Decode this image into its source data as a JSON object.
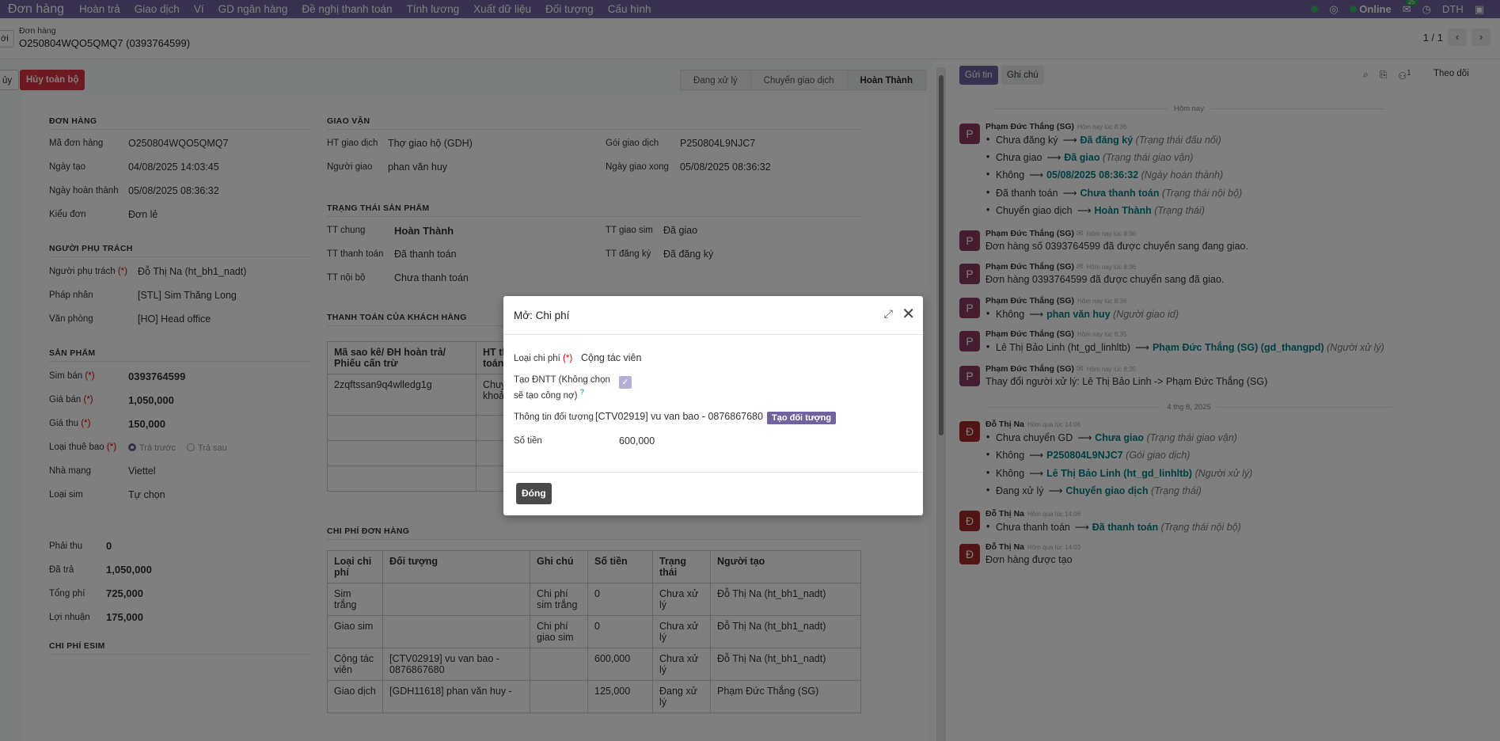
{
  "nav": {
    "app": "Đơn hàng",
    "menus": [
      "Hoàn trả",
      "Giao dịch",
      "Ví",
      "GD ngân hàng",
      "Đề nghị thanh toán",
      "Tính lương",
      "Xuất dữ liệu",
      "Đối tượng",
      "Cấu hình"
    ],
    "status": "Online",
    "msg_count": "25",
    "company": "DTH"
  },
  "control": {
    "new_label": "ới",
    "breadcrumb_parent": "Đơn hàng",
    "breadcrumb_current": "O250804WQO5QMQ7 (0393764599)",
    "pager": "1 / 1"
  },
  "statusbar": {
    "cancel_label": "ủy",
    "cancel_all_label": "Hủy toàn bộ",
    "steps": [
      "Đang xử lý",
      "Chuyển giao dịch",
      "Hoàn Thành"
    ]
  },
  "order": {
    "title": "ĐƠN HÀNG",
    "code_label": "Mã đơn hàng",
    "code": "O250804WQO5QMQ7",
    "created_label": "Ngày tạo",
    "created": "04/08/2025 14:03:45",
    "done_label": "Ngày hoàn thành",
    "done": "05/08/2025 08:36:32",
    "type_label": "Kiểu đơn",
    "type": "Đơn lẻ"
  },
  "owner": {
    "title": "NGƯỜI PHỤ TRÁCH",
    "person_label": "Người phụ trách",
    "person": "Đỗ Thị Na (ht_bh1_nadt)",
    "entity_label": "Pháp nhân",
    "entity": "[STL] Sim Thăng Long",
    "office_label": "Văn phòng",
    "office": "[HO] Head office"
  },
  "product": {
    "title": "SẢN PHẨM",
    "sim_label": "Sim bán",
    "sim": "0393764599",
    "price_label": "Giá bán",
    "price": "1,050,000",
    "collect_label": "Giá thu",
    "collect": "150,000",
    "sub_label": "Loại thuê bao",
    "sub_opt1": "Trả trước",
    "sub_opt2": "Trả sau",
    "carrier_label": "Nhà mạng",
    "carrier": "Viettel",
    "simtype_label": "Loại sim",
    "simtype": "Tự chọn"
  },
  "totals": {
    "due_label": "Phải thu",
    "due": "0",
    "paid_label": "Đã trả",
    "paid": "1,050,000",
    "fee_label": "Tổng phí",
    "fee": "725,000",
    "profit_label": "Lợi nhuận",
    "profit": "175,000",
    "esim_title": "CHI PHÍ ESIM"
  },
  "delivery": {
    "title": "GIAO VẬN",
    "method_label": "HT giao dịch",
    "method": "Thợ giao hộ (GDH)",
    "pack_label": "Gói giao dịch",
    "pack": "P250804L9NJC7",
    "shipper_label": "Người giao",
    "shipper": "phan văn huy",
    "ship_done_label": "Ngày giao xong",
    "ship_done": "05/08/2025 08:36:32"
  },
  "pstatus": {
    "title": "TRẠNG THÁI SẢN PHẨM",
    "general_label": "TT chung",
    "general": "Hoàn Thành",
    "simdel_label": "TT giao sim",
    "simdel": "Đã giao",
    "pay_label": "TT thanh toán",
    "pay": "Đã thanh toán",
    "reg_label": "TT đăng ký",
    "reg": "Đã đăng ký",
    "internal_label": "TT nội bộ",
    "internal": "Chưa thanh toán"
  },
  "payment": {
    "title": "THANH TOÁN CỦA KHÁCH HÀNG",
    "col1": "Mã sao kê/ ĐH hoàn trả/ Phiếu cấn trừ",
    "col2": "HT th toán",
    "row1_c1": "2zqftssan9q4wlledg1g",
    "row1_c2": "Chuyể khoản"
  },
  "costs": {
    "title": "CHI PHÍ ĐƠN HÀNG",
    "headers": [
      "Loại chi phí",
      "Đối tượng",
      "Ghi chú",
      "Số tiền",
      "Trạng thái",
      "Người tạo"
    ],
    "rows": [
      [
        "Sim trắng",
        "",
        "Chi phí sim trắng",
        "0",
        "Chưa xử lý",
        "Đỗ Thị Na (ht_bh1_nadt)"
      ],
      [
        "Giao sim",
        "",
        "Chi phí giao sim",
        "0",
        "Chưa xử lý",
        "Đỗ Thị Na (ht_bh1_nadt)"
      ],
      [
        "Cộng tác viên",
        "[CTV02919] vu van bao - 0876867680",
        "",
        "600,000",
        "Chưa xử lý",
        "Đỗ Thị Na (ht_bh1_nadt)"
      ],
      [
        "Giao dịch",
        "[GDH11618] phan văn huy -",
        "",
        "125,000",
        "Đang xử lý",
        "Phạm Đức Thắng (SG)"
      ]
    ]
  },
  "chatter": {
    "send_label": "Gửi tin",
    "note_label": "Ghi chú",
    "follow_label": "Theo dõi",
    "follower_count": "1",
    "day_today": "Hôm nay",
    "day_old": "4 thg 8, 2025",
    "author_p": "Phạm Đức Thắng (SG)",
    "author_d": "Đỗ Thị Na",
    "t836": "Hôm nay lúc 8:36",
    "t835": "Hôm nay lúc 8:35",
    "t1406": "Hôm qua lúc 14:06",
    "t1403": "Hôm qua lúc 14:03",
    "m1": [
      {
        "old": "Chưa đăng ký",
        "new": "Đã đăng ký",
        "field": "(Trạng thái đấu nối)"
      },
      {
        "old": "Chưa giao",
        "new": "Đã giao",
        "field": "(Trạng thái giao vận)"
      },
      {
        "old": "Không",
        "new": "05/08/2025 08:36:32",
        "field": "(Ngày hoàn thành)"
      },
      {
        "old": "Đã thanh toán",
        "new": "Chưa thanh toán",
        "field": "(Trạng thái nội bộ)"
      },
      {
        "old": "Chuyển giao dịch",
        "new": "Hoàn Thành",
        "field": "(Trạng thái)"
      }
    ],
    "m2": "Đơn hàng số 0393764599 đã được chuyển sang đang giao.",
    "m3": "Đơn hàng 0393764599 đã được chuyển sang đã giao.",
    "m4": {
      "old": "Không",
      "new": "phan văn huy",
      "field": "(Người giao id)"
    },
    "m5": {
      "old": "Lê Thị Bảo Linh (ht_gd_linhltb)",
      "new": "Phạm Đức Thắng (SG) (gd_thangpd)",
      "field": "(Người xử lý)"
    },
    "m6": "Thay đổi người xử lý: Lê Thị Bảo Linh -> Phạm Đức Thắng (SG)",
    "m7": [
      {
        "old": "Chưa chuyển GD",
        "new": "Chưa giao",
        "field": "(Trạng thái giao vận)"
      },
      {
        "old": "Không",
        "new": "P250804L9NJC7",
        "field": "(Gói giao dịch)"
      },
      {
        "old": "Không",
        "new": "Lê Thị Bảo Linh (ht_gd_linhltb)",
        "field": "(Người xử lý)"
      },
      {
        "old": "Đang xử lý",
        "new": "Chuyển giao dịch",
        "field": "(Trạng thái)"
      }
    ],
    "m8": {
      "old": "Chưa thanh toán",
      "new": "Đã thanh toán",
      "field": "(Trạng thái nội bộ)"
    },
    "m9": "Đơn hàng được tạo"
  },
  "modal": {
    "title": "Mở: Chi phí",
    "type_label": "Loại chi phí",
    "type_value": "Cộng tác viên",
    "create_label": "Tạo ĐNTT (Không chọn sẽ tạo công nợ)",
    "create_help": "?",
    "obj_label": "Thông tin đối tượng",
    "obj_value": "[CTV02919] vu van bao - 0876867680",
    "obj_btn": "Tạo đối tượng",
    "amount_label": "Số tiền",
    "amount": "600,000",
    "close_label": "Đóng",
    "required_mark": "(*)"
  }
}
